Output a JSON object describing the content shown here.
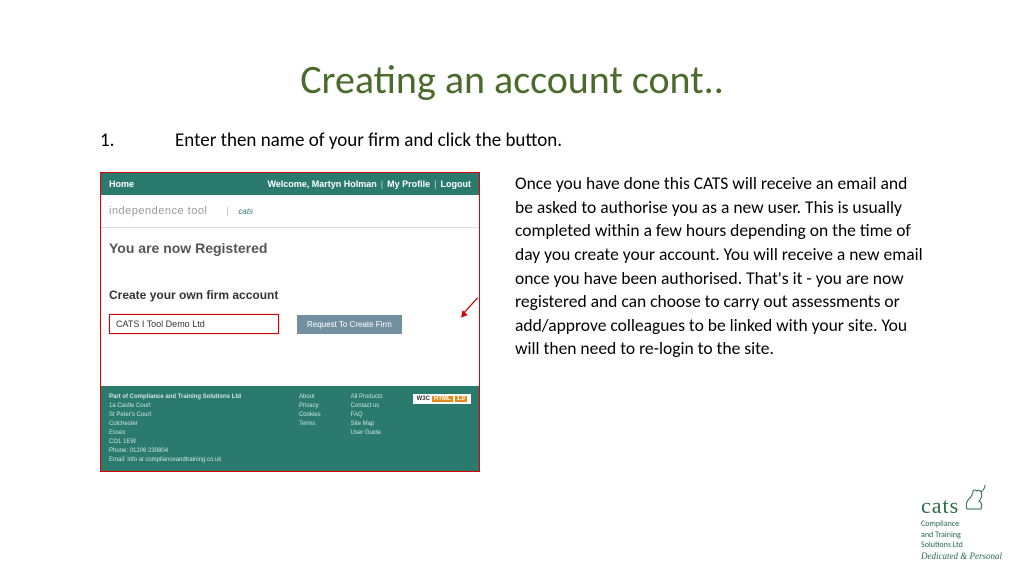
{
  "title": "Creating an account cont..",
  "step": {
    "number": "1.",
    "text": "Enter then name of your firm and click the button."
  },
  "description": "Once you have done this CATS will receive an email and be asked to authorise you as a new user. This is usually completed within a few hours depending on the time of day you create your account. You will receive a new email once you have been authorised. That's it - you are now registered and can choose to carry out assessments or add/approve colleagues to be linked with your site. You will then need to re-login to the site.",
  "app": {
    "header": {
      "home": "Home",
      "welcome": "Welcome, Martyn Holman",
      "profile": "My Profile",
      "logout": "Logout"
    },
    "subheader": {
      "tool": "independence tool",
      "logo": "cats"
    },
    "body": {
      "registered": "You are now Registered",
      "create": "Create your own firm account",
      "input_value": "CATS I Tool Demo Ltd",
      "button": "Request To Create Firm"
    },
    "footer": {
      "address": {
        "l1": "Part of Compliance and Training Solutions Ltd",
        "l2": "1a Castle Court",
        "l3": "St Peter's Court",
        "l4": "Colchester",
        "l5": "Essex",
        "l6": "CO1 1EW",
        "l7": "Phone: 01206 230804",
        "l8": "Email: info at complianceandtraining.co.uk"
      },
      "col2": {
        "l1": "About",
        "l2": "Privacy",
        "l3": "Cookies",
        "l4": "Terms"
      },
      "col3": {
        "l1": "All Products",
        "l2": "Contact us",
        "l3": "FAQ",
        "l4": "Site Map",
        "l5": "User Guide"
      },
      "badge": {
        "w3c": "W3C",
        "html": "HTML",
        "ver": "1.0"
      }
    }
  },
  "corner": {
    "brand": "cats",
    "sub1": "Compliance",
    "sub2": "and Training",
    "sub3": "Solutions Ltd",
    "tagline": "Dedicated & Personal"
  }
}
